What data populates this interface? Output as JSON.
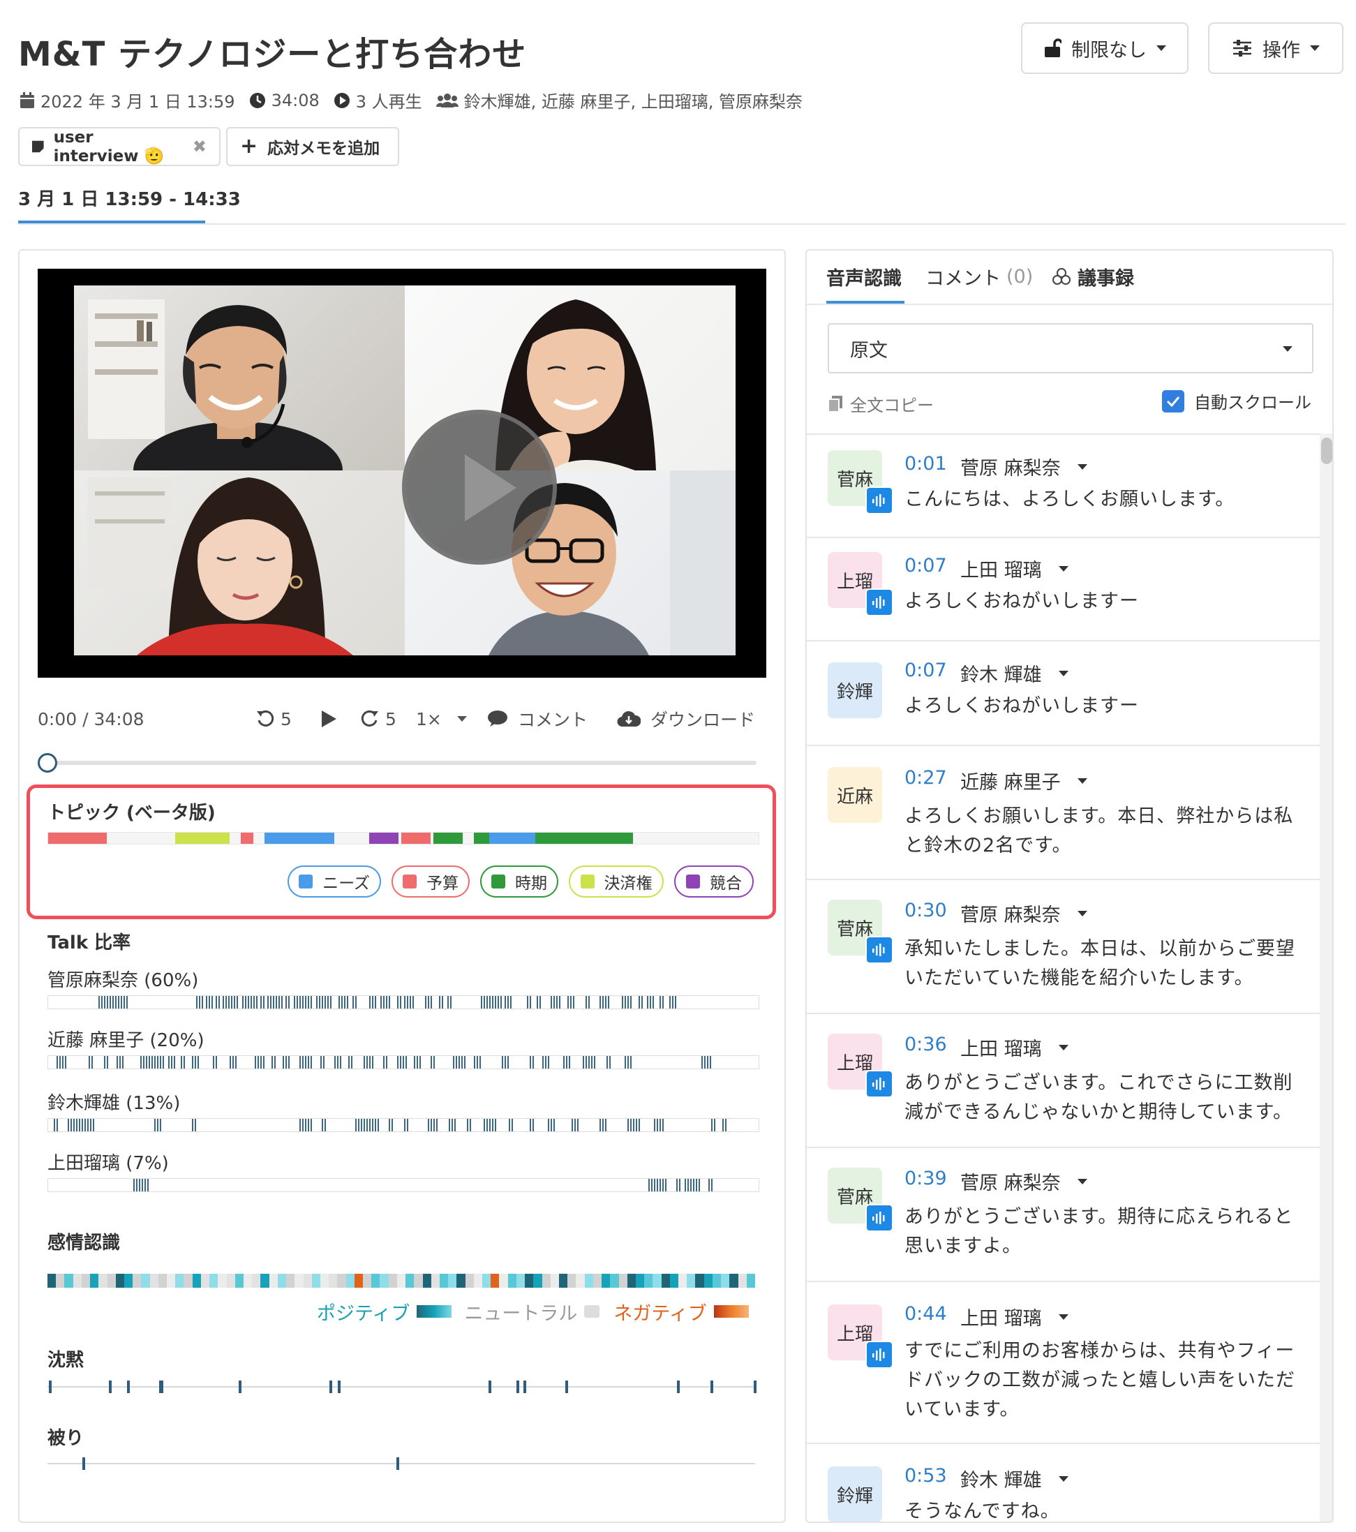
{
  "header": {
    "title": "M&T テクノロジーと打ち合わせ",
    "restrict_label": "制限なし",
    "actions_label": "操作"
  },
  "meta": {
    "date": "2022 年 3 月 1 日  13:59",
    "duration": "34:08",
    "plays": "3 人再生",
    "participants": "鈴木輝雄, 近藤 麻里子, 上田瑠璃, 管原麻梨奈"
  },
  "chips": {
    "tag_label": "user interview 🫡",
    "add_memo_label": "応対メモを追加"
  },
  "date_tab": "3 月 1 日  13:59 - 14:33",
  "player": {
    "time": "0:00 / 34:08",
    "rewind": "5",
    "forward": "5",
    "speed": "1×",
    "comment": "コメント",
    "download": "ダウンロード",
    "progress": 0
  },
  "topics": {
    "title": "トピック (ベータ版)",
    "legend": [
      {
        "label": "ニーズ",
        "color": "#4a9be8"
      },
      {
        "label": "予算",
        "color": "#f06b6b"
      },
      {
        "label": "時期",
        "color": "#2e9a3a"
      },
      {
        "label": "決済権",
        "color": "#cde24a"
      },
      {
        "label": "競合",
        "color": "#8e44b5"
      }
    ]
  },
  "talk": {
    "title": "Talk 比率",
    "speakers": [
      {
        "label": "管原麻梨奈 (60%)"
      },
      {
        "label": "近藤 麻里子 (20%)"
      },
      {
        "label": "鈴木輝雄 (13%)"
      },
      {
        "label": "上田瑠璃 (7%)"
      }
    ]
  },
  "emotion": {
    "title": "感情認識",
    "positive": "ポジティブ",
    "neutral": "ニュートラル",
    "negative": "ネガティブ",
    "colors": {
      "positive": "#1a9fb0",
      "neutral": "#c9c9c9",
      "negative": "#e0621b"
    }
  },
  "silence": {
    "title": "沈黙"
  },
  "overlap": {
    "title": "被り"
  },
  "right": {
    "tab_transcript": "音声認識",
    "tab_comments": "コメント",
    "tab_comments_count": "(0)",
    "tab_minutes": "議事録",
    "select_value": "原文",
    "copy_label": "全文コピー",
    "autoscroll_label": "自動スクロール",
    "autoscroll_checked": true
  },
  "transcript": [
    {
      "avatar": "菅麻",
      "avatar_color": "#e3f2e1",
      "voice": true,
      "time": "0:01",
      "name": "菅原 麻梨奈",
      "text": "こんにちは、よろしくお願いします。"
    },
    {
      "avatar": "上瑠",
      "avatar_color": "#fbe1ec",
      "voice": true,
      "time": "0:07",
      "name": "上田 瑠璃",
      "text": "よろしくおねがいしますー"
    },
    {
      "avatar": "鈴輝",
      "avatar_color": "#dbeaf8",
      "voice": false,
      "time": "0:07",
      "name": "鈴木 輝雄",
      "text": "よろしくおねがいしますー"
    },
    {
      "avatar": "近麻",
      "avatar_color": "#fdf1d8",
      "voice": false,
      "time": "0:27",
      "name": "近藤 麻里子",
      "text": "よろしくお願いします。本日、弊社からは私と鈴木の2名です。"
    },
    {
      "avatar": "菅麻",
      "avatar_color": "#e3f2e1",
      "voice": true,
      "time": "0:30",
      "name": "菅原 麻梨奈",
      "text": "承知いたしました。本日は、以前からご要望いただいていた機能を紹介いたします。"
    },
    {
      "avatar": "上瑠",
      "avatar_color": "#fbe1ec",
      "voice": true,
      "time": "0:36",
      "name": "上田 瑠璃",
      "text": "ありがとうございます。これでさらに工数削減ができるんじゃないかと期待しています。"
    },
    {
      "avatar": "菅麻",
      "avatar_color": "#e3f2e1",
      "voice": true,
      "time": "0:39",
      "name": "菅原 麻梨奈",
      "text": "ありがとうございます。期待に応えられると思いますよ。"
    },
    {
      "avatar": "上瑠",
      "avatar_color": "#fbe1ec",
      "voice": true,
      "time": "0:44",
      "name": "上田 瑠璃",
      "text": "すでにご利用のお客様からは、共有やフィードバックの工数が減ったと嬉しい声をいただいています。"
    },
    {
      "avatar": "鈴輝",
      "avatar_color": "#dbeaf8",
      "voice": false,
      "time": "0:53",
      "name": "鈴木 輝雄",
      "text": "そうなんですね。"
    }
  ]
}
